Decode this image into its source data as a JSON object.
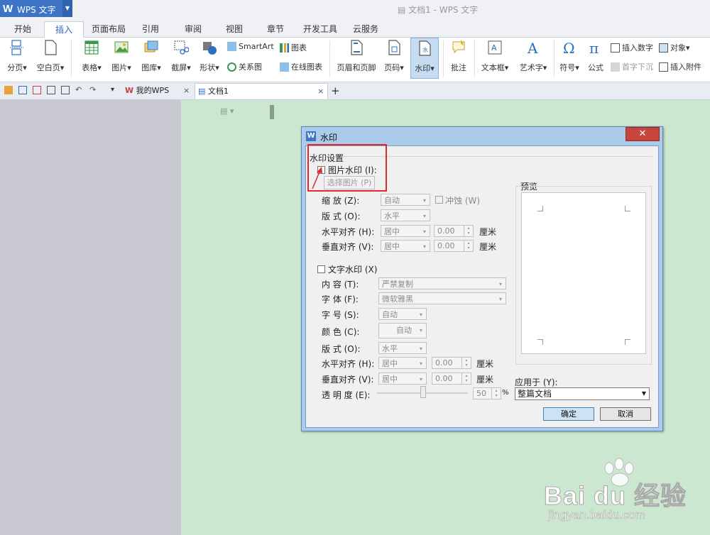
{
  "app": {
    "name": "WPS 文字",
    "window_title": "文档1 - WPS 文字"
  },
  "ribbon_tabs": [
    "开始",
    "插入",
    "页面布局",
    "引用",
    "审阅",
    "视图",
    "章节",
    "开发工具",
    "云服务"
  ],
  "active_tab": "插入",
  "ribbon": {
    "page_break": "分页",
    "blank_page": "空白页",
    "table": "表格",
    "picture": "图片",
    "gallery": "图库",
    "screenshot": "截屏",
    "shape": "形状",
    "smartart": "SmartArt",
    "chart": "图表",
    "relation": "关系图",
    "online_chart": "在线图表",
    "header_footer": "页眉和页脚",
    "page_number": "页码",
    "watermark": "水印",
    "comment": "批注",
    "textbox": "文本框",
    "wordart": "艺术字",
    "symbol": "符号",
    "formula": "公式",
    "insert_number": "插入数字",
    "object": "对象",
    "drop_cap": "首字下沉",
    "attachment": "插入附件"
  },
  "doc_tabs": [
    "我的WPS",
    "文档1"
  ],
  "dialog": {
    "title": "水印",
    "close": "✕",
    "section": "水印设置",
    "picture_wm": {
      "label": "图片水印  (I):",
      "choose_btn": "选择图片  (P)",
      "scale_label": "缩      放  (Z):",
      "scale_value": "自动",
      "washout_label": "冲蚀  (W)",
      "layout_label": "版      式  (O):",
      "layout_value": "水平",
      "halign_label": "水平对齐  (H):",
      "halign_value": "居中",
      "halign_num": "0.00",
      "valign_label": "垂直对齐  (V):",
      "valign_value": "居中",
      "valign_num": "0.00",
      "unit": "厘米"
    },
    "text_wm": {
      "label": "文字水印  (X)",
      "content_label": "内      容  (T):",
      "content_value": "严禁复制",
      "font_label": "字      体  (F):",
      "font_value": "微软雅黑",
      "size_label": "字      号  (S):",
      "size_value": "自动",
      "color_label": "颜      色  (C):",
      "color_value": "自动",
      "layout_label": "版      式  (O):",
      "layout_value": "水平",
      "halign_label": "水平对齐  (H):",
      "halign_value": "居中",
      "halign_num": "0.00",
      "valign_label": "垂直对齐  (V):",
      "valign_value": "居中",
      "valign_num": "0.00",
      "unit": "厘米",
      "transparency_label": "透  明  度  (E):",
      "transparency_value": "50",
      "percent": "%"
    },
    "preview_label": "预览",
    "apply_label": "应用于  (Y):",
    "apply_value": "整篇文档",
    "ok": "确定",
    "cancel": "取消"
  },
  "watermark_logo": {
    "brand": "Bai du 经验",
    "url": "jingyan.baidu.com"
  }
}
